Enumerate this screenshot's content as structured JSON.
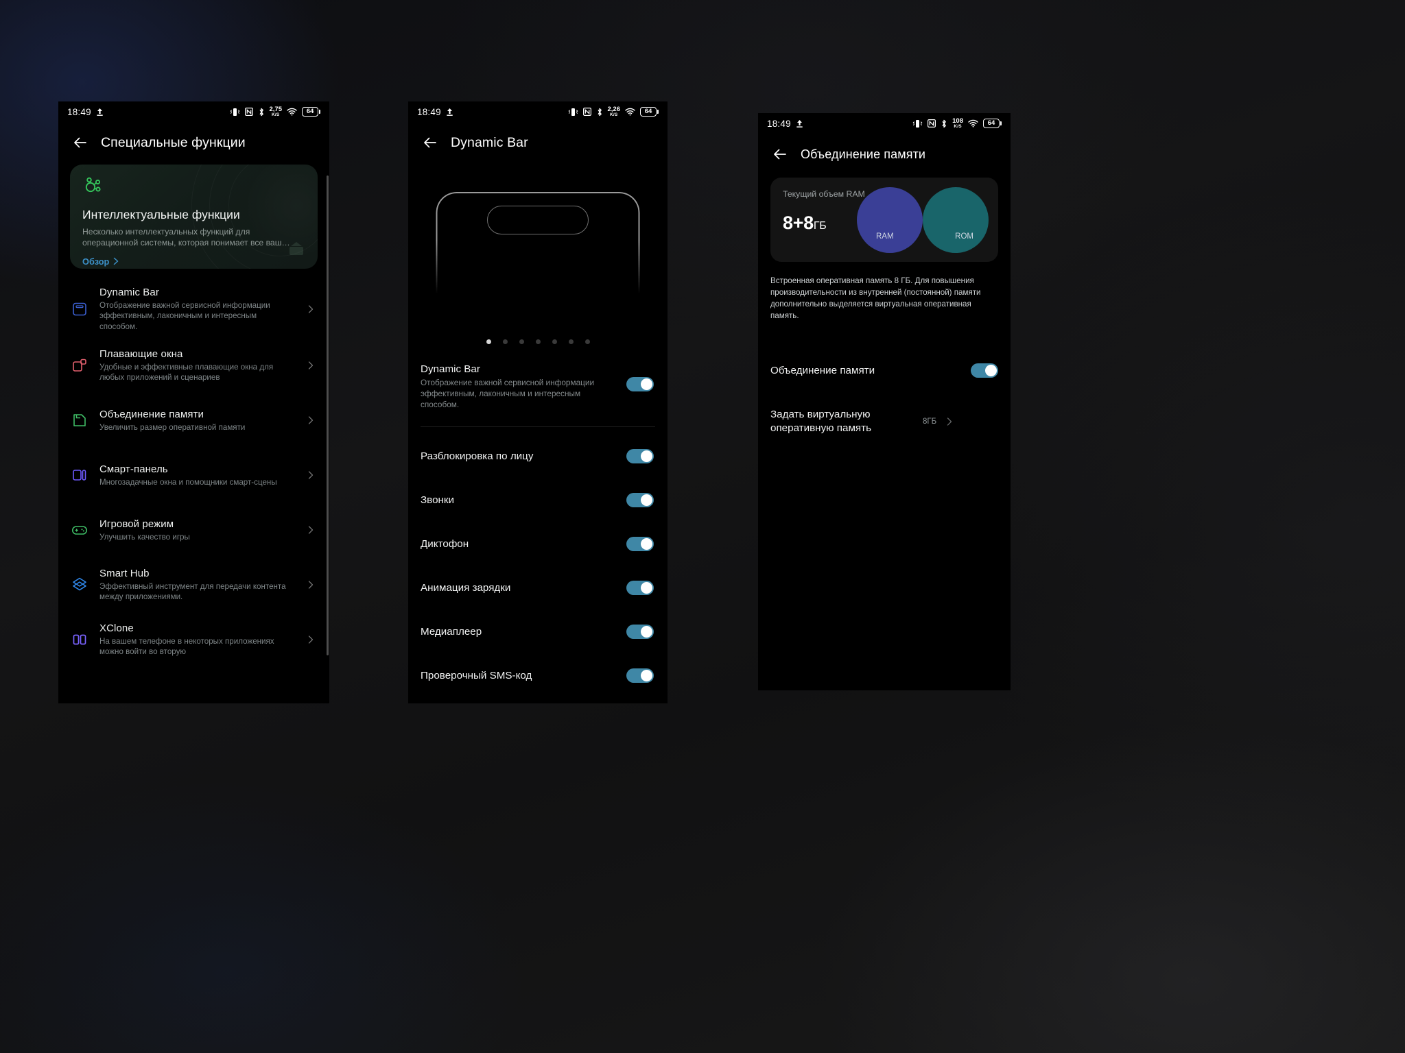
{
  "panel1": {
    "status": {
      "time": "18:49",
      "upload_icon": "upload-arrow-icon",
      "icons": [
        "vibrate-icon",
        "nfc-icon",
        "bluetooth-icon"
      ],
      "net_speed_value": "2,75",
      "net_speed_unit": "K/S",
      "wifi_icon": "wifi-icon",
      "battery_level": "64"
    },
    "appbar": {
      "back": "back-arrow-icon",
      "title": "Специальные функции"
    },
    "hero": {
      "icon": "smart-functions-icon",
      "title": "Интеллектуальные функции",
      "subtitle": "Несколько интеллектуальных функций для операционной системы, которая понимает все ваш…",
      "link": "Обзор"
    },
    "items": [
      {
        "icon": "dynamic-bar-icon",
        "icon_color": "#3b5fd0",
        "title": "Dynamic Bar",
        "subtitle": "Отображение важной сервисной информации эффективным, лаконичным и интересным способом."
      },
      {
        "icon": "floating-windows-icon",
        "icon_color": "#e4616f",
        "title": "Плавающие окна",
        "subtitle": "Удобные и эффективные плавающие окна для любых приложений и сценариев"
      },
      {
        "icon": "memory-fusion-icon",
        "icon_color": "#3fbd66",
        "title": "Объединение памяти",
        "subtitle": "Увеличить размер оперативной памяти"
      },
      {
        "icon": "smart-panel-icon",
        "icon_color": "#6f5bff",
        "title": "Смарт-панель",
        "subtitle": "Многозадачные окна и помощники смарт-сцены"
      },
      {
        "icon": "game-mode-icon",
        "icon_color": "#3fbd66",
        "title": "Игровой режим",
        "subtitle": "Улучшить качество игры"
      },
      {
        "icon": "smart-hub-icon",
        "icon_color": "#2f86e8",
        "title": "Smart Hub",
        "subtitle": "Эффективный инструмент для передачи контента между приложениями."
      },
      {
        "icon": "xclone-icon",
        "icon_color": "#7a63ff",
        "title": "XClone",
        "subtitle": "На вашем телефоне в некоторых приложениях можно войти во вторую"
      }
    ]
  },
  "panel2": {
    "status": {
      "time": "18:49",
      "net_speed_value": "2,26",
      "net_speed_unit": "K/S",
      "battery_level": "64"
    },
    "appbar": {
      "back": "back-arrow-icon",
      "title": "Dynamic Bar"
    },
    "illustration": {
      "dots_total": 7,
      "dots_active_index": 0
    },
    "main_toggle": {
      "title": "Dynamic Bar",
      "subtitle": "Отображение важной сервисной информации эффективным, лаконичным и интересным способом.",
      "enabled": true
    },
    "toggles": [
      {
        "title": "Разблокировка по лицу",
        "enabled": true
      },
      {
        "title": "Звонки",
        "enabled": true
      },
      {
        "title": "Диктофон",
        "enabled": true
      },
      {
        "title": "Анимация зарядки",
        "enabled": true
      },
      {
        "title": "Медиаплеер",
        "enabled": true
      },
      {
        "title": "Проверочный SMS-код",
        "enabled": true
      }
    ]
  },
  "panel3": {
    "status": {
      "time": "18:49",
      "net_speed_value": "108",
      "net_speed_unit": "K/S",
      "battery_level": "64"
    },
    "appbar": {
      "back": "back-arrow-icon",
      "title": "Объединение памяти"
    },
    "card": {
      "label": "Текущий объем RAM",
      "value": "8+8",
      "unit": "ГБ",
      "ram_label": "RAM",
      "rom_label": "ROM",
      "ram_color": "#3a3f96",
      "rom_color": "#1a6e73"
    },
    "description": "Встроенная оперативная память 8 ГБ. Для повышения производительности из внутренней (постоянной) памяти дополнительно выделяется виртуальная оперативная память.",
    "toggle_row": {
      "title": "Объединение памяти",
      "enabled": true
    },
    "value_row": {
      "title": "Задать виртуальную оперативную память",
      "value": "8ГБ"
    }
  },
  "theme": {
    "accent_toggle": "#3f87a6",
    "link": "#3c91c9",
    "background": "#000000"
  }
}
